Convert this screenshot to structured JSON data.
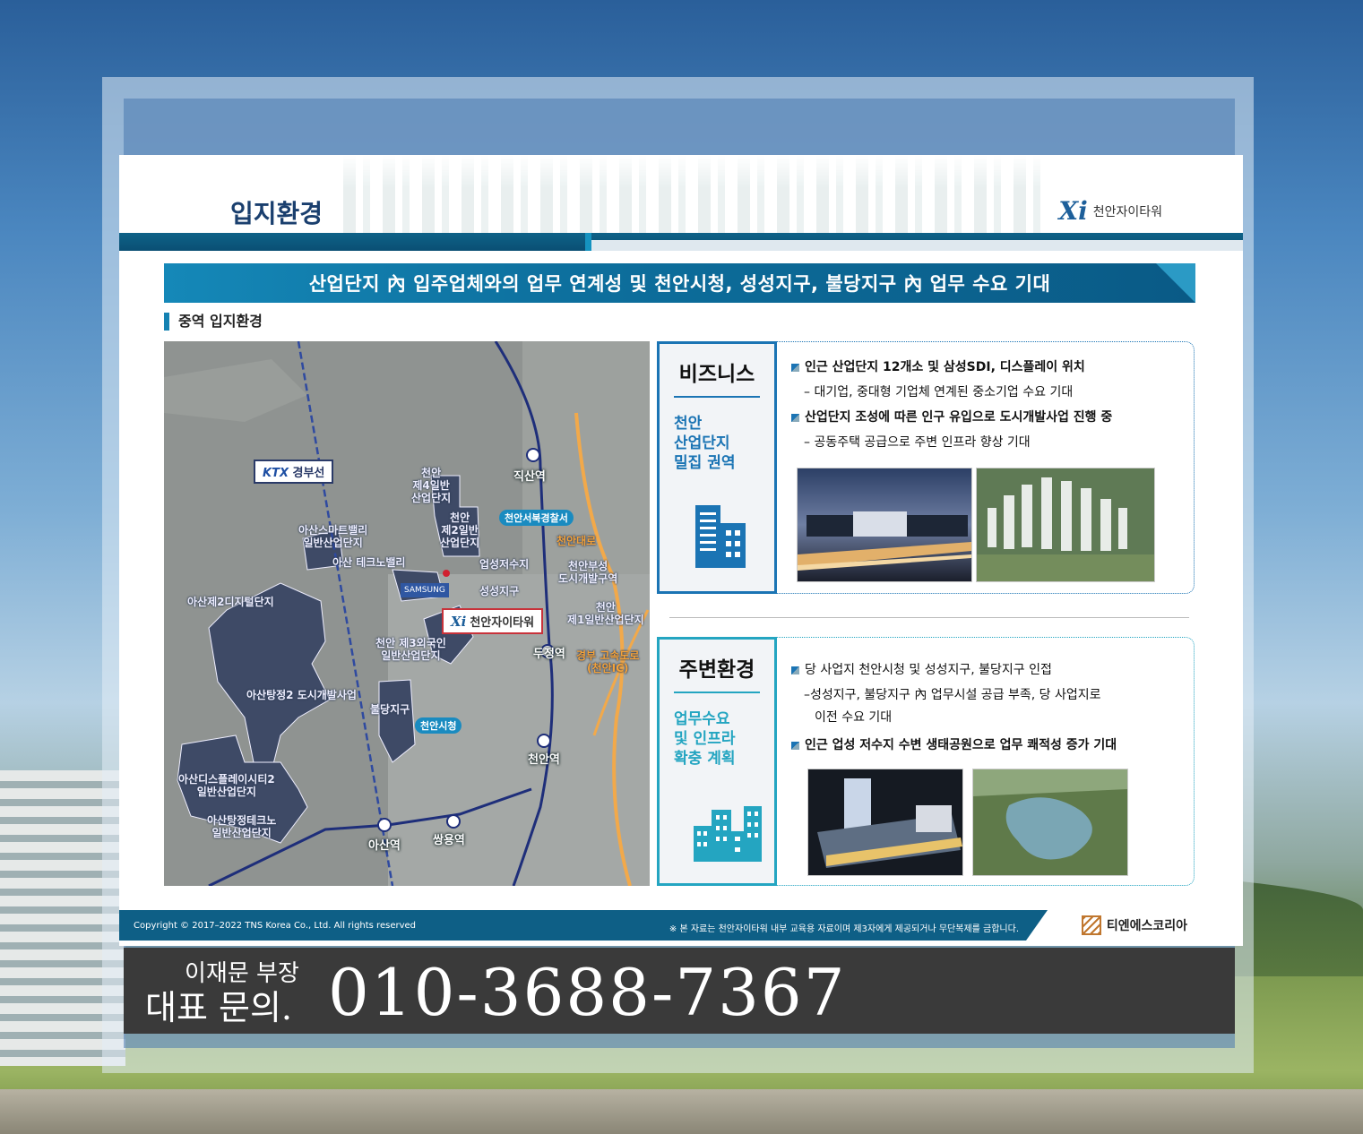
{
  "slide": {
    "title": "입지환경",
    "logo_mark": "Xi",
    "logo_text": "천안자이타워",
    "banner": "산업단지 內 입주업체와의 업무 연계성 및 천안시청, 성성지구, 불당지구 內 업무 수요 기대",
    "section_label": "중역 입지환경"
  },
  "map": {
    "ktx_logo": "KTX",
    "ktx_label": "경부선",
    "callout_mark": "Xi",
    "callout_label": "천안자이타워",
    "areas": [
      "천안\n제4일반\n산업단지",
      "천안\n제2일반\n산업단지",
      "아산스마트밸리\n일반산업단지",
      "아산 테크노밸리",
      "아산제2디지털단지",
      "천안 제3외국인\n일반산업단지",
      "아산탕정2 도시개발사업",
      "불당지구",
      "성성지구",
      "업성저수지",
      "천안부성\n도시개발구역",
      "천안\n제1일반산업단지",
      "아산디스플레이시티2\n일반산업단지",
      "아산탕정테크노\n일반산업단지"
    ],
    "stations": [
      "직산역",
      "두정역",
      "천안역",
      "쌍용역",
      "아산역"
    ],
    "pills": [
      "천안서북경찰서",
      "천안시청"
    ],
    "roads": [
      "천안대로",
      "경부 고속도로\n(천안IC)"
    ],
    "samsung": "SAMSUNG"
  },
  "business": {
    "heading": "비즈니스",
    "subheading": "천안\n산업단지\n밀집 권역",
    "icon": "building-icon",
    "bullets": [
      {
        "main": "인근 산업단지 12개소 및 삼성SDI, 디스플레이 위치",
        "sub": "– 대기업, 중대형 기업체 연계된 중소기업 수요 기대"
      },
      {
        "main": "산업단지 조성에 따른 인구 유입으로 도시개발사업 진행 중",
        "sub": "– 공동주택 공급으로 주변 인프라 향상 기대"
      }
    ]
  },
  "environment": {
    "heading": "주변환경",
    "subheading": "업무수요\n및 인프라\n확충 계획",
    "icon": "city-buildings-icon",
    "bullet1": "당 사업지 천안시청 및 성성지구, 불당지구 인접",
    "sub1a": "–성성지구, 불당지구 內 업무시설 공급 부족, 당 사업지로",
    "sub1b": "이전 수요 기대",
    "bullet2": "인근 업성 저수지 수변 생태공원으로 업무 쾌적성 증가 기대"
  },
  "footer": {
    "copyright": "Copyright © 2017–2022 TNS Korea Co., Ltd.  All rights reserved",
    "note": "※ 본 자료는 천안자이타워 내부 교육용 자료이며 제3자에게 제공되거나 무단복제를 금합니다.",
    "brand": "티엔에스코리아"
  },
  "contact": {
    "name": "이재문 부장",
    "label": "대표 문의.",
    "phone": "010-3688-7367"
  },
  "colors": {
    "brand_blue": "#1b74b4",
    "teal": "#24a5c1",
    "footer": "#0e5f86",
    "area_fill": "#3e4a66"
  }
}
